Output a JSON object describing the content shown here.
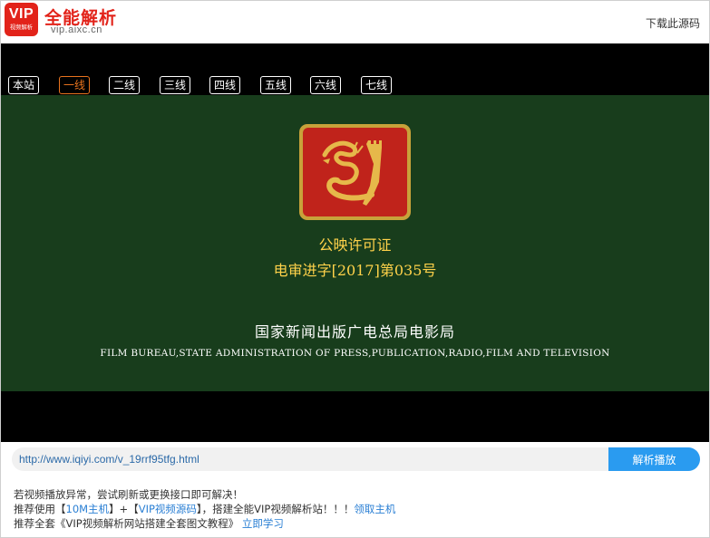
{
  "header": {
    "logo_badge_big": "VIP",
    "logo_badge_small": "视频解析",
    "title": "全能解析",
    "domain": "vip.aixc.cn",
    "download_link": "下载此源码"
  },
  "player": {
    "lines": [
      "本站",
      "一线",
      "二线",
      "三线",
      "四线",
      "五线",
      "六线",
      "七线"
    ],
    "active_line": "一线",
    "video": {
      "license_title": "公映许可证",
      "license_number": "电审进字[2017]第035号",
      "bureau_cn": "国家新闻出版广电总局电影局",
      "bureau_en": "FILM BUREAU,STATE ADMINISTRATION OF PRESS,PUBLICATION,RADIO,FILM AND TELEVISION",
      "background_color": "#183d1c",
      "text_gold_color": "#ffd24a"
    }
  },
  "parse_bar": {
    "url_value": "http://www.iqiyi.com/v_19rrf95tfg.html",
    "button_label": "解析播放",
    "button_color": "#2a9bf0"
  },
  "notes": {
    "line1": "若视频播放异常，尝试刷新或更换接口即可解决！",
    "line2_prefix": "推荐使用【",
    "line2_link1": "10M主机",
    "line2_mid1": "】+【",
    "line2_link2": "VIP视频源码",
    "line2_mid2": "】，搭建全能VIP视频解析站！！！",
    "line2_link3": "领取主机",
    "line3_prefix": "推荐全套《VIP视频解析网站搭建全套图文教程》",
    "line3_link": "立即学习",
    "link_color": "#2a7fd4"
  }
}
